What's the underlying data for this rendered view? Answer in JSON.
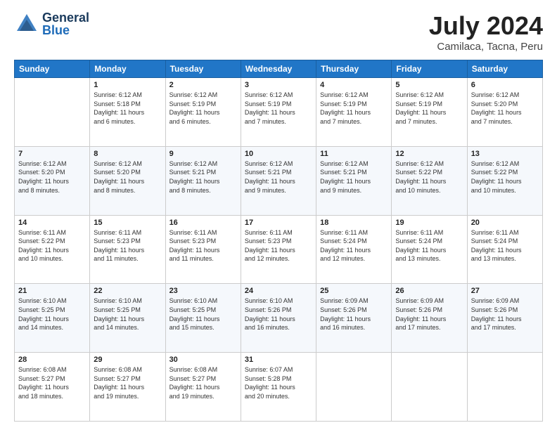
{
  "header": {
    "logo": {
      "general": "General",
      "blue": "Blue"
    },
    "title": "July 2024",
    "location": "Camilaca, Tacna, Peru"
  },
  "calendar": {
    "days_of_week": [
      "Sunday",
      "Monday",
      "Tuesday",
      "Wednesday",
      "Thursday",
      "Friday",
      "Saturday"
    ],
    "weeks": [
      [
        {
          "day": "",
          "info": ""
        },
        {
          "day": "1",
          "info": "Sunrise: 6:12 AM\nSunset: 5:18 PM\nDaylight: 11 hours\nand 6 minutes."
        },
        {
          "day": "2",
          "info": "Sunrise: 6:12 AM\nSunset: 5:19 PM\nDaylight: 11 hours\nand 6 minutes."
        },
        {
          "day": "3",
          "info": "Sunrise: 6:12 AM\nSunset: 5:19 PM\nDaylight: 11 hours\nand 7 minutes."
        },
        {
          "day": "4",
          "info": "Sunrise: 6:12 AM\nSunset: 5:19 PM\nDaylight: 11 hours\nand 7 minutes."
        },
        {
          "day": "5",
          "info": "Sunrise: 6:12 AM\nSunset: 5:19 PM\nDaylight: 11 hours\nand 7 minutes."
        },
        {
          "day": "6",
          "info": "Sunrise: 6:12 AM\nSunset: 5:20 PM\nDaylight: 11 hours\nand 7 minutes."
        }
      ],
      [
        {
          "day": "7",
          "info": "Sunrise: 6:12 AM\nSunset: 5:20 PM\nDaylight: 11 hours\nand 8 minutes."
        },
        {
          "day": "8",
          "info": "Sunrise: 6:12 AM\nSunset: 5:20 PM\nDaylight: 11 hours\nand 8 minutes."
        },
        {
          "day": "9",
          "info": "Sunrise: 6:12 AM\nSunset: 5:21 PM\nDaylight: 11 hours\nand 8 minutes."
        },
        {
          "day": "10",
          "info": "Sunrise: 6:12 AM\nSunset: 5:21 PM\nDaylight: 11 hours\nand 9 minutes."
        },
        {
          "day": "11",
          "info": "Sunrise: 6:12 AM\nSunset: 5:21 PM\nDaylight: 11 hours\nand 9 minutes."
        },
        {
          "day": "12",
          "info": "Sunrise: 6:12 AM\nSunset: 5:22 PM\nDaylight: 11 hours\nand 10 minutes."
        },
        {
          "day": "13",
          "info": "Sunrise: 6:12 AM\nSunset: 5:22 PM\nDaylight: 11 hours\nand 10 minutes."
        }
      ],
      [
        {
          "day": "14",
          "info": "Sunrise: 6:11 AM\nSunset: 5:22 PM\nDaylight: 11 hours\nand 10 minutes."
        },
        {
          "day": "15",
          "info": "Sunrise: 6:11 AM\nSunset: 5:23 PM\nDaylight: 11 hours\nand 11 minutes."
        },
        {
          "day": "16",
          "info": "Sunrise: 6:11 AM\nSunset: 5:23 PM\nDaylight: 11 hours\nand 11 minutes."
        },
        {
          "day": "17",
          "info": "Sunrise: 6:11 AM\nSunset: 5:23 PM\nDaylight: 11 hours\nand 12 minutes."
        },
        {
          "day": "18",
          "info": "Sunrise: 6:11 AM\nSunset: 5:24 PM\nDaylight: 11 hours\nand 12 minutes."
        },
        {
          "day": "19",
          "info": "Sunrise: 6:11 AM\nSunset: 5:24 PM\nDaylight: 11 hours\nand 13 minutes."
        },
        {
          "day": "20",
          "info": "Sunrise: 6:11 AM\nSunset: 5:24 PM\nDaylight: 11 hours\nand 13 minutes."
        }
      ],
      [
        {
          "day": "21",
          "info": "Sunrise: 6:10 AM\nSunset: 5:25 PM\nDaylight: 11 hours\nand 14 minutes."
        },
        {
          "day": "22",
          "info": "Sunrise: 6:10 AM\nSunset: 5:25 PM\nDaylight: 11 hours\nand 14 minutes."
        },
        {
          "day": "23",
          "info": "Sunrise: 6:10 AM\nSunset: 5:25 PM\nDaylight: 11 hours\nand 15 minutes."
        },
        {
          "day": "24",
          "info": "Sunrise: 6:10 AM\nSunset: 5:26 PM\nDaylight: 11 hours\nand 16 minutes."
        },
        {
          "day": "25",
          "info": "Sunrise: 6:09 AM\nSunset: 5:26 PM\nDaylight: 11 hours\nand 16 minutes."
        },
        {
          "day": "26",
          "info": "Sunrise: 6:09 AM\nSunset: 5:26 PM\nDaylight: 11 hours\nand 17 minutes."
        },
        {
          "day": "27",
          "info": "Sunrise: 6:09 AM\nSunset: 5:26 PM\nDaylight: 11 hours\nand 17 minutes."
        }
      ],
      [
        {
          "day": "28",
          "info": "Sunrise: 6:08 AM\nSunset: 5:27 PM\nDaylight: 11 hours\nand 18 minutes."
        },
        {
          "day": "29",
          "info": "Sunrise: 6:08 AM\nSunset: 5:27 PM\nDaylight: 11 hours\nand 19 minutes."
        },
        {
          "day": "30",
          "info": "Sunrise: 6:08 AM\nSunset: 5:27 PM\nDaylight: 11 hours\nand 19 minutes."
        },
        {
          "day": "31",
          "info": "Sunrise: 6:07 AM\nSunset: 5:28 PM\nDaylight: 11 hours\nand 20 minutes."
        },
        {
          "day": "",
          "info": ""
        },
        {
          "day": "",
          "info": ""
        },
        {
          "day": "",
          "info": ""
        }
      ]
    ]
  }
}
